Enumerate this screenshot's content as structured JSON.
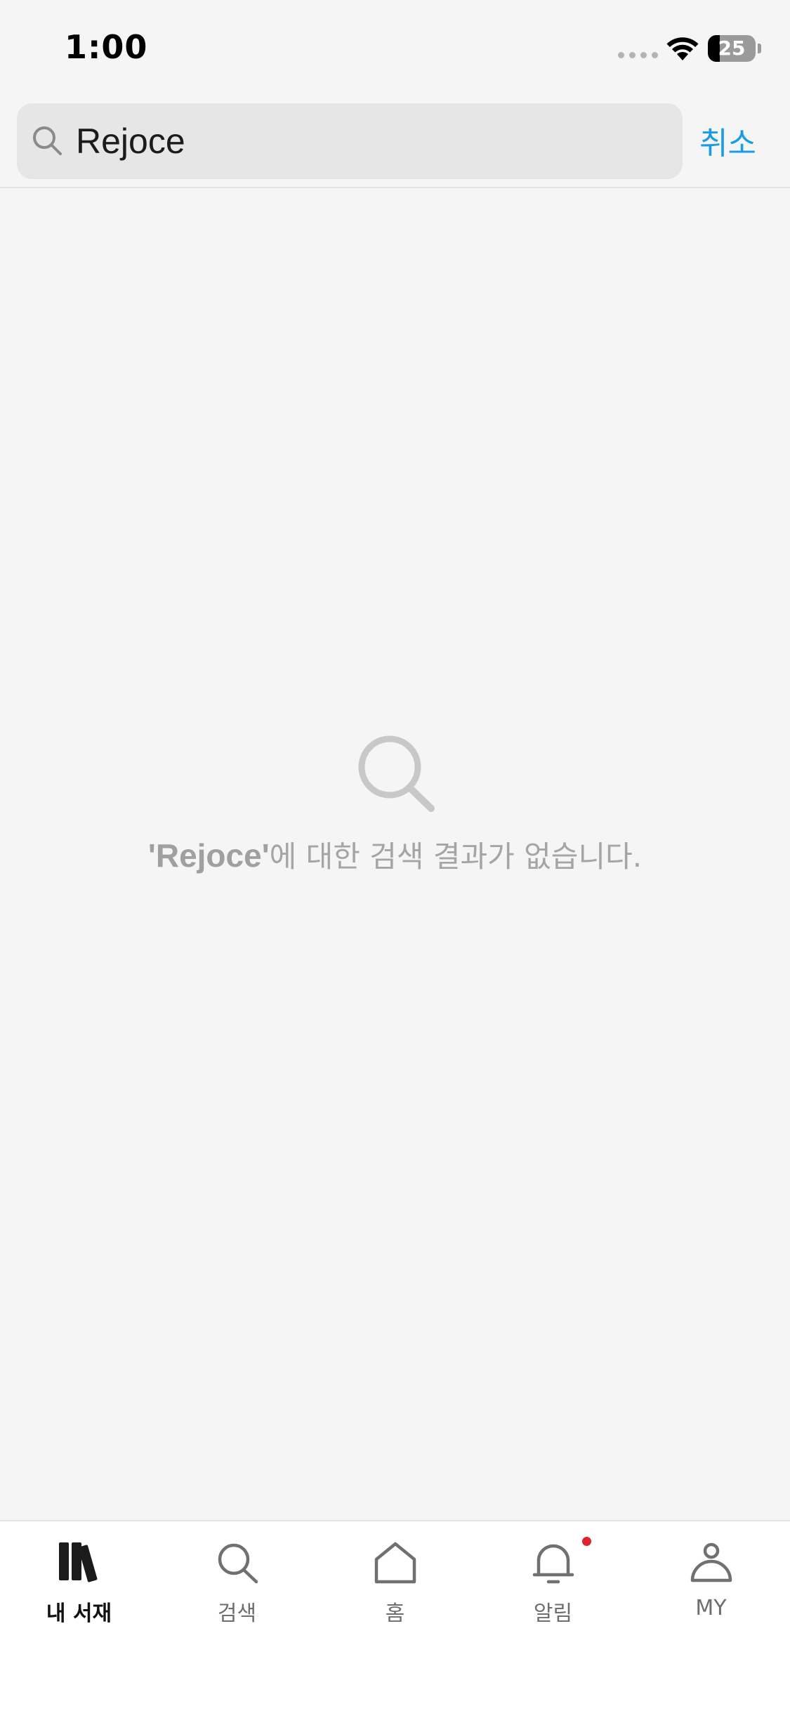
{
  "status_bar": {
    "time": "1:00",
    "battery_level": "25",
    "battery_fraction": 0.25
  },
  "search": {
    "query": "Rejoce",
    "cancel_label": "취소",
    "icon": "search-icon"
  },
  "empty_state": {
    "icon": "magnifier-icon",
    "query_quoted": "'Rejoce'",
    "message_suffix": "에 대한 검색 결과가 없습니다."
  },
  "tab_bar": {
    "tabs": [
      {
        "label": "내 서재",
        "icon": "library-icon",
        "active": true
      },
      {
        "label": "검색",
        "icon": "search-icon",
        "active": false
      },
      {
        "label": "홈",
        "icon": "home-icon",
        "active": false
      },
      {
        "label": "알림",
        "icon": "bell-icon",
        "active": false,
        "badge": true
      },
      {
        "label": "MY",
        "icon": "person-icon",
        "active": false
      }
    ]
  },
  "colors": {
    "accent": "#1a9be6",
    "badge": "#e0232b",
    "background": "#f5f5f5"
  }
}
